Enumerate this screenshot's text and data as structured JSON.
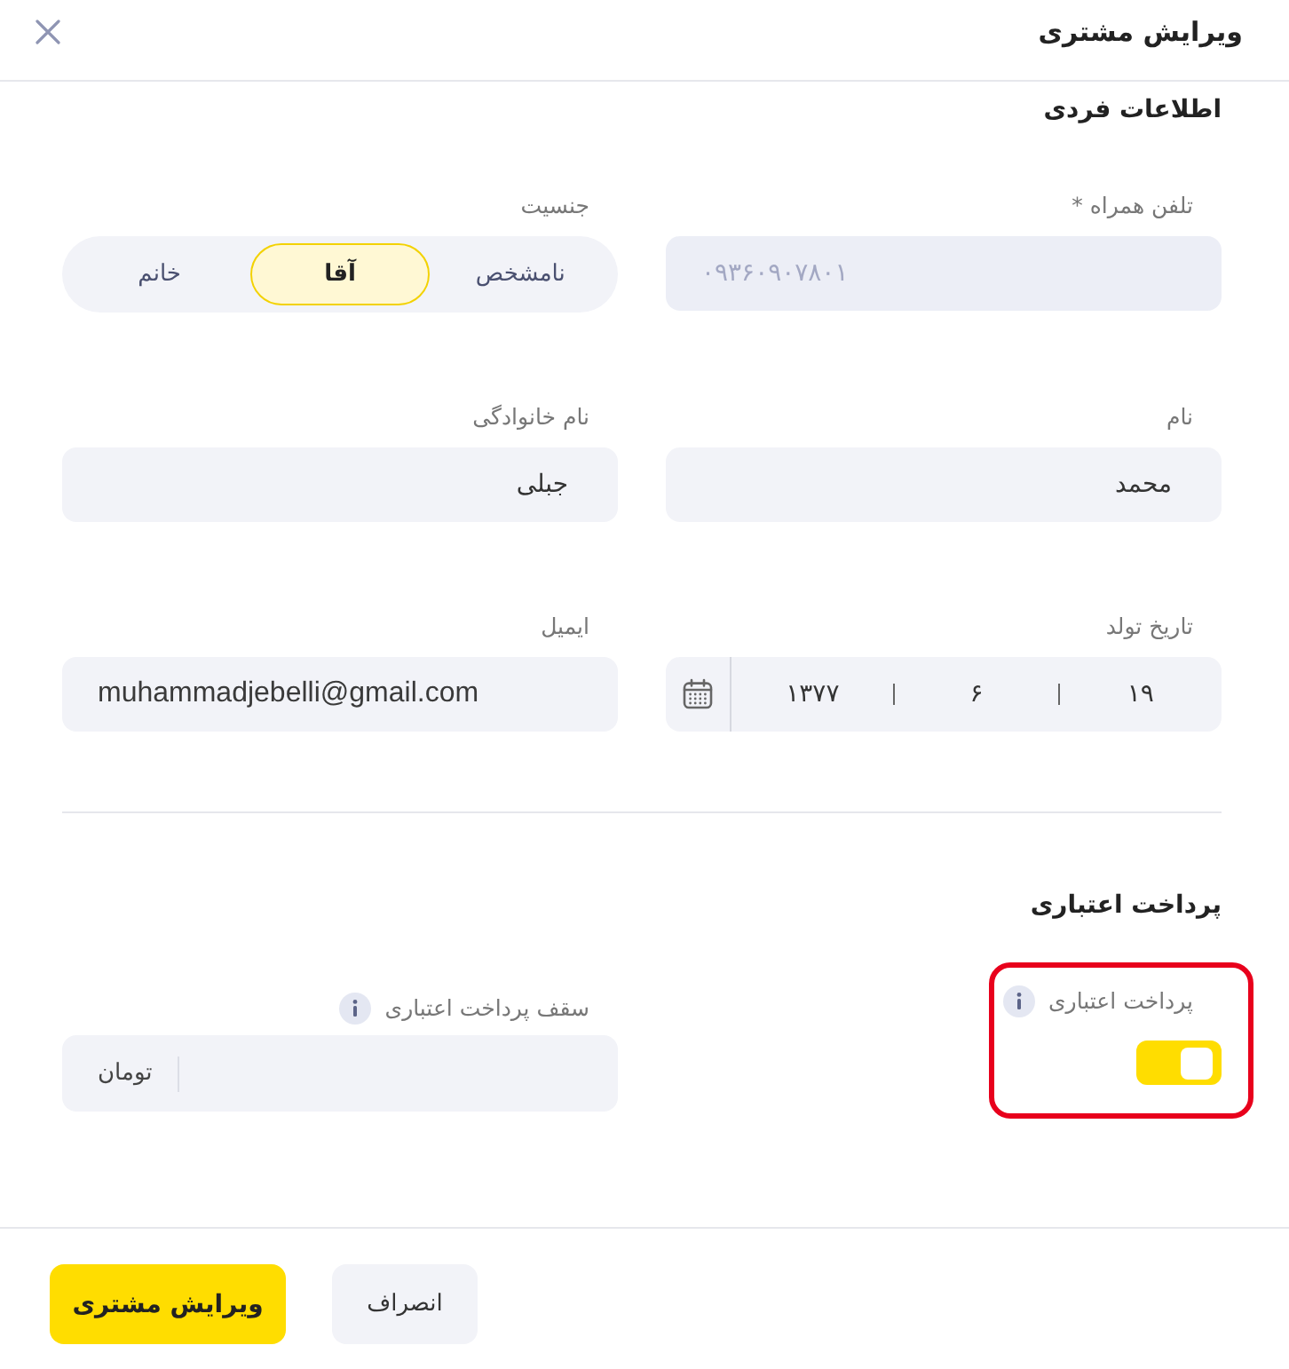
{
  "header": {
    "title": "ویرایش مشتری"
  },
  "personal": {
    "heading": "اطلاعات فردی",
    "phone": {
      "label": "تلفن همراه *",
      "value": "۰۹۳۶۰۹۰۷۸۰۱",
      "disabled": true
    },
    "gender": {
      "label": "جنسیت",
      "options": [
        {
          "label": "نامشخص",
          "selected": false
        },
        {
          "label": "آقا",
          "selected": true
        },
        {
          "label": "خانم",
          "selected": false
        }
      ]
    },
    "first_name": {
      "label": "نام",
      "value": "محمد"
    },
    "last_name": {
      "label": "نام خانوادگی",
      "value": "جبلی"
    },
    "birth_date": {
      "label": "تاریخ تولد",
      "day": "۱۹",
      "month": "۶",
      "year": "۱۳۷۷"
    },
    "email": {
      "label": "ایمیل",
      "value": "muhammadjebelli@gmail.com"
    }
  },
  "credit": {
    "heading": "پرداخت اعتباری",
    "toggle": {
      "label": "پرداخت اعتباری",
      "on": true,
      "highlighted": true
    },
    "limit": {
      "label": "سقف پرداخت اعتباری",
      "unit": "تومان"
    }
  },
  "footer": {
    "buttons": [
      {
        "label": "انصراف",
        "kind": "secondary"
      },
      {
        "label": "ویرایش مشتری",
        "kind": "primary"
      }
    ]
  }
}
